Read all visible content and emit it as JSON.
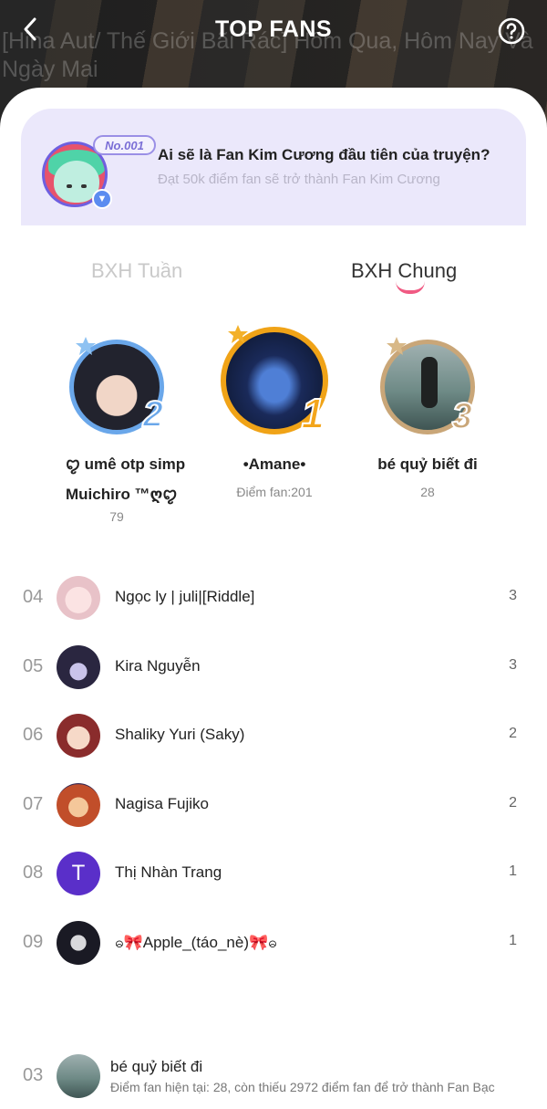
{
  "header": {
    "title": "TOP FANS",
    "background_title": "[Hina Aut/ Thế Giới Bãi Rác] Hôm Qua, Hôm Nay Và Ngày Mai"
  },
  "banner": {
    "badge": "No.001",
    "title": "Ai sẽ là Fan Kim Cương đầu tiên của truyện?",
    "subtitle": "Đạt 50k điểm fan sẽ trở thành Fan Kim Cương"
  },
  "tabs": [
    {
      "label": "BXH Tuần",
      "active": false
    },
    {
      "label": "BXH Chung",
      "active": true
    }
  ],
  "podium": [
    {
      "rank": "2",
      "name": "ꨄ︎ umê otp simp Muichiro ™ღꨄ︎",
      "score": "79"
    },
    {
      "rank": "1",
      "name": "•Amane•",
      "score": "Điểm fan:201"
    },
    {
      "rank": "3",
      "name": "bé quỷ biết đi",
      "score": "28"
    }
  ],
  "list": [
    {
      "rank": "04",
      "name": "Ngọc ly | juli|[Riddle]",
      "score": "3"
    },
    {
      "rank": "05",
      "name": "Kira Nguyễn",
      "score": "3"
    },
    {
      "rank": "06",
      "name": "Shaliky Yuri (Saky)",
      "score": "2"
    },
    {
      "rank": "07",
      "name": "Nagisa Fujiko",
      "score": "2"
    },
    {
      "rank": "08",
      "name": "Thị Nhàn Trang",
      "score": "1",
      "initial": "T"
    },
    {
      "rank": "09",
      "name": "ဓ🎀Apple_(táo_nè)🎀ဓ",
      "score": "1"
    }
  ],
  "me": {
    "rank": "03",
    "name": "bé quỷ biết đi",
    "status": "Điểm fan hiện tại: 28, còn thiếu 2972 điểm fan để trở thành Fan Bạc"
  },
  "colors": {
    "accent_pink": "#f05a83",
    "gold": "#f0a317",
    "silver_blue": "#6aa7ea",
    "bronze": "#c9a678",
    "banner_bg": "#ebe8fb"
  }
}
